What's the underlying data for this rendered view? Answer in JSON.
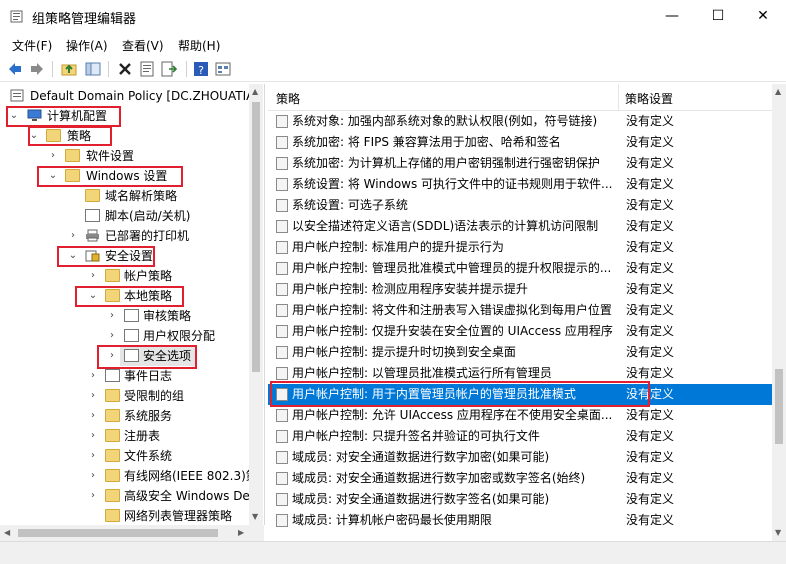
{
  "window": {
    "title": "组策略管理编辑器",
    "controls": {
      "minimize": "—",
      "maximize": "☐",
      "close": "✕"
    }
  },
  "menu": [
    "文件(F)",
    "操作(A)",
    "查看(V)",
    "帮助(H)"
  ],
  "toolbar_icons": [
    "back-icon",
    "forward-icon",
    "up-folder-icon",
    "show-hide-tree-icon",
    "delete-icon",
    "properties-icon",
    "export-list-icon",
    "help-icon",
    "view-icon"
  ],
  "tree": [
    {
      "label": "Default Domain Policy [DC.ZHOUATIA",
      "expander": "",
      "icon": "policy"
    },
    {
      "label": "计算机配置",
      "expander": "⌄",
      "icon": "computer"
    },
    {
      "label": "策略",
      "expander": "⌄",
      "icon": "folder"
    },
    {
      "label": "软件设置",
      "expander": "›",
      "icon": "folder"
    },
    {
      "label": "Windows 设置",
      "expander": "⌄",
      "icon": "folder"
    },
    {
      "label": "域名解析策略",
      "expander": "",
      "icon": "doc"
    },
    {
      "label": "脚本(启动/关机)",
      "expander": "",
      "icon": "doc"
    },
    {
      "label": "已部署的打印机",
      "expander": "›",
      "icon": "printer"
    },
    {
      "label": "安全设置",
      "expander": "⌄",
      "icon": "security"
    },
    {
      "label": "帐户策略",
      "expander": "›",
      "icon": "folder"
    },
    {
      "label": "本地策略",
      "expander": "⌄",
      "icon": "folder"
    },
    {
      "label": "审核策略",
      "expander": "›",
      "icon": "doc"
    },
    {
      "label": "用户权限分配",
      "expander": "›",
      "icon": "doc"
    },
    {
      "label": "安全选项",
      "expander": "›",
      "icon": "doc"
    },
    {
      "label": "事件日志",
      "expander": "›",
      "icon": "folder"
    },
    {
      "label": "受限制的组",
      "expander": "›",
      "icon": "folder"
    },
    {
      "label": "系统服务",
      "expander": "›",
      "icon": "folder"
    },
    {
      "label": "注册表",
      "expander": "›",
      "icon": "folder"
    },
    {
      "label": "文件系统",
      "expander": "›",
      "icon": "folder"
    },
    {
      "label": "有线网络(IEEE 802.3)策",
      "expander": "›",
      "icon": "folder"
    },
    {
      "label": "高级安全 Windows De",
      "expander": "›",
      "icon": "folder"
    },
    {
      "label": "网络列表管理器策略",
      "expander": "",
      "icon": "folder"
    }
  ],
  "list": {
    "col_policy": "策略",
    "col_setting": "策略设置",
    "rows": [
      {
        "policy": "系统对象: 加强内部系统对象的默认权限(例如，符号链接)",
        "setting": "没有定义"
      },
      {
        "policy": "系统加密: 将 FIPS 兼容算法用于加密、哈希和签名",
        "setting": "没有定义"
      },
      {
        "policy": "系统加密: 为计算机上存储的用户密钥强制进行强密钥保护",
        "setting": "没有定义"
      },
      {
        "policy": "系统设置: 将 Windows 可执行文件中的证书规则用于软件...",
        "setting": "没有定义"
      },
      {
        "policy": "系统设置: 可选子系统",
        "setting": "没有定义"
      },
      {
        "policy": "以安全描述符定义语言(SDDL)语法表示的计算机访问限制",
        "setting": "没有定义"
      },
      {
        "policy": "用户帐户控制: 标准用户的提升提示行为",
        "setting": "没有定义"
      },
      {
        "policy": "用户帐户控制: 管理员批准模式中管理员的提升权限提示的...",
        "setting": "没有定义"
      },
      {
        "policy": "用户帐户控制: 检测应用程序安装并提示提升",
        "setting": "没有定义"
      },
      {
        "policy": "用户帐户控制: 将文件和注册表写入错误虚拟化到每用户位置",
        "setting": "没有定义"
      },
      {
        "policy": "用户帐户控制: 仅提升安装在安全位置的 UIAccess 应用程序",
        "setting": "没有定义"
      },
      {
        "policy": "用户帐户控制: 提示提升时切换到安全桌面",
        "setting": "没有定义"
      },
      {
        "policy": "用户帐户控制: 以管理员批准模式运行所有管理员",
        "setting": "没有定义"
      },
      {
        "policy": "用户帐户控制: 用于内置管理员帐户的管理员批准模式",
        "setting": "没有定义"
      },
      {
        "policy": "用户帐户控制: 允许 UIAccess 应用程序在不使用安全桌面...",
        "setting": "没有定义"
      },
      {
        "policy": "用户帐户控制: 只提升签名并验证的可执行文件",
        "setting": "没有定义"
      },
      {
        "policy": "域成员: 对安全通道数据进行数字加密(如果可能)",
        "setting": "没有定义"
      },
      {
        "policy": "域成员: 对安全通道数据进行数字加密或数字签名(始终)",
        "setting": "没有定义"
      },
      {
        "policy": "域成员: 对安全通道数据进行数字签名(如果可能)",
        "setting": "没有定义"
      },
      {
        "policy": "域成员: 计算机帐户密码最长使用期限",
        "setting": "没有定义"
      }
    ]
  },
  "colors": {
    "selection": "#0078d7",
    "annotation": "#e0202f"
  }
}
